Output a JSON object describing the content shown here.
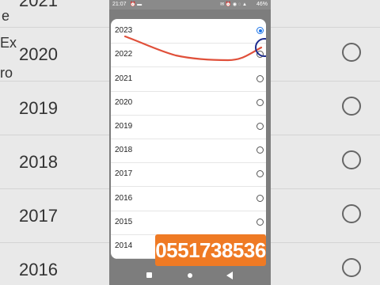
{
  "status_bar": {
    "time": "21:07",
    "battery": "46%"
  },
  "background": {
    "years": [
      "2021",
      "2020",
      "2019",
      "2018",
      "2017",
      "2016"
    ],
    "fragments": [
      "e",
      "Ex",
      "ro"
    ]
  },
  "year_options": [
    {
      "label": "2023",
      "selected": true
    },
    {
      "label": "2022",
      "selected": false
    },
    {
      "label": "2021",
      "selected": false
    },
    {
      "label": "2020",
      "selected": false
    },
    {
      "label": "2019",
      "selected": false
    },
    {
      "label": "2018",
      "selected": false
    },
    {
      "label": "2017",
      "selected": false
    },
    {
      "label": "2016",
      "selected": false
    },
    {
      "label": "2015",
      "selected": false
    },
    {
      "label": "2014",
      "selected": false
    }
  ],
  "overlay": {
    "phone_number": "0551738536"
  },
  "colors": {
    "accent": "#1a73e8",
    "annotation_curve": "#e0503a",
    "banner": "#ef7a24"
  },
  "nav_icons": [
    "recents-icon",
    "home-icon",
    "back-icon"
  ]
}
